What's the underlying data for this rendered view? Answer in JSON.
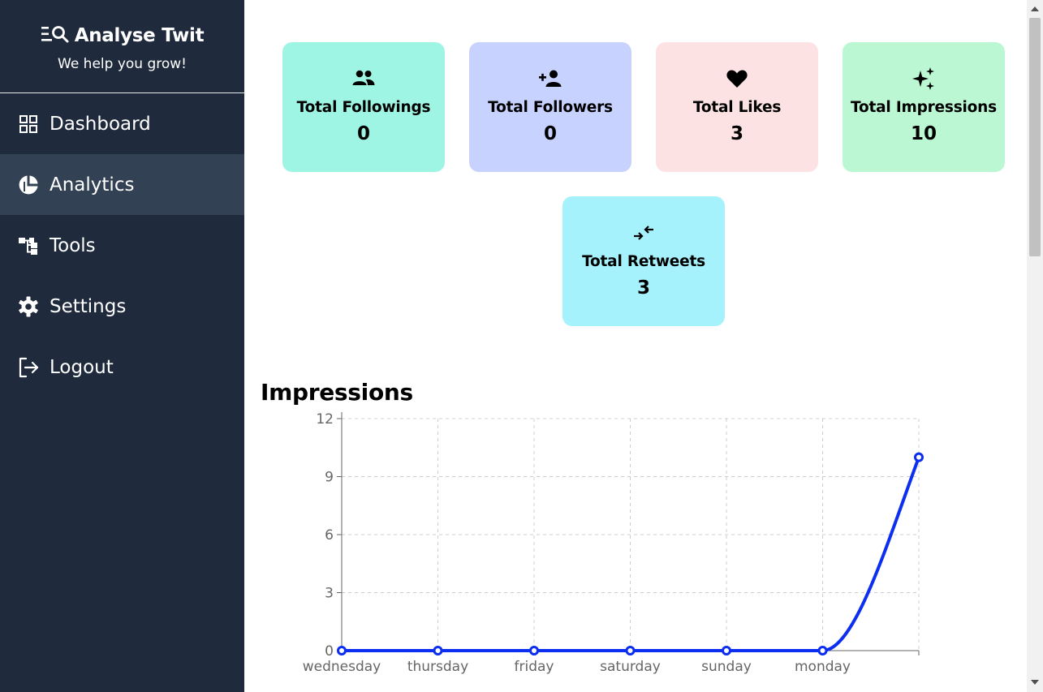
{
  "brand": {
    "title": "Analyse Twit",
    "subtitle": "We help you grow!"
  },
  "nav": [
    {
      "label": "Dashboard",
      "icon": "grid-icon"
    },
    {
      "label": "Analytics",
      "icon": "pie-chart-icon",
      "active": true
    },
    {
      "label": "Tools",
      "icon": "sitemap-icon"
    },
    {
      "label": "Settings",
      "icon": "gear-icon"
    },
    {
      "label": "Logout",
      "icon": "logout-icon"
    }
  ],
  "stats": [
    {
      "label": "Total Followings",
      "value": "0",
      "color": "#9ef5e4",
      "icon": "group-icon"
    },
    {
      "label": "Total Followers",
      "value": "0",
      "color": "#c8d2fe",
      "icon": "person-add-icon"
    },
    {
      "label": "Total Likes",
      "value": "3",
      "color": "#fde2e3",
      "icon": "heart-icon"
    },
    {
      "label": "Total Impressions",
      "value": "10",
      "color": "#bbf7d2",
      "icon": "sparkles-icon"
    },
    {
      "label": "Total Retweets",
      "value": "3",
      "color": "#a5f2fc",
      "icon": "arrows-in-icon"
    }
  ],
  "chart_data": {
    "type": "line",
    "title": "Impressions",
    "categories": [
      "wednesday",
      "thursday",
      "friday",
      "saturday",
      "sunday",
      "monday",
      ""
    ],
    "series": [
      {
        "values": [
          0,
          0,
          0,
          0,
          0,
          0,
          10
        ]
      }
    ],
    "ylim": [
      0,
      12
    ],
    "yticks": [
      0,
      3,
      6,
      9,
      12
    ],
    "grid": true,
    "line_color": "#0c2ef0"
  }
}
